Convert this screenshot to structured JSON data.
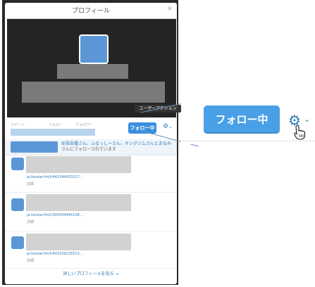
{
  "modal": {
    "title": "プロフィール",
    "close": "×"
  },
  "stats": {
    "tweets_label": "ツイート",
    "following_label": "フォロー",
    "followers_label": "フォロワー"
  },
  "actions": {
    "follow_label": "フォロー中",
    "gear_icon": "⚙",
    "caret": "⌄",
    "tooltip": "ユーザーアクション"
  },
  "followers_line": {
    "names": "安倍吾優さん、ふなっしーさん、キングジムさんとまなみ",
    "suffix": "さんにフォローされています"
  },
  "tweets": [
    {
      "link": "ja.favstar.fm/t/442344433127...",
      "detail": "詳細"
    },
    {
      "link": "ja.favstar.fm/t/300434445138...",
      "detail": "詳細"
    },
    {
      "link": "ja.favstar.fm/t/442339235513...",
      "detail": "詳細"
    }
  ],
  "more_link": "詳しいプロフィールを見る →",
  "zoom": {
    "follow_label": "フォロー中",
    "gear_icon": "⚙",
    "caret": "⌄"
  },
  "colors": {
    "accent": "#3a8fde",
    "link": "#2b7bb9",
    "placeholder": "#5b97d6"
  }
}
